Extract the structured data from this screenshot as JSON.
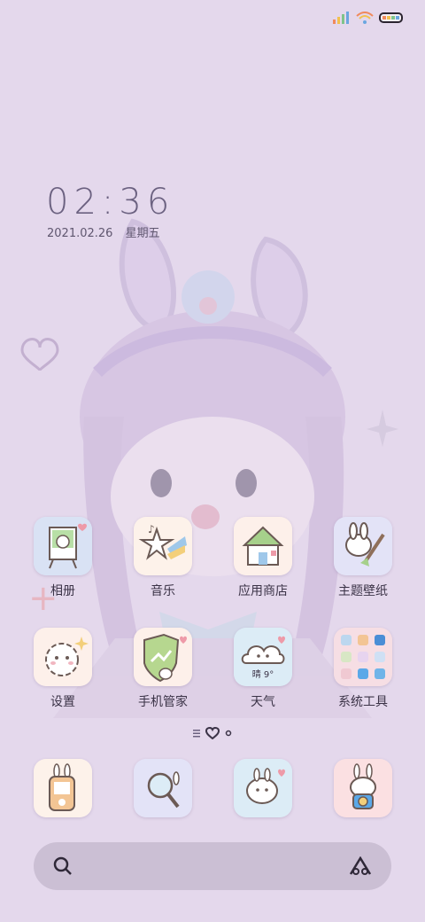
{
  "clock": {
    "time": "02:36",
    "date": "2021.02.26",
    "weekday": "星期五"
  },
  "status_bar": {
    "icons": [
      "signal-icon",
      "wifi-icon",
      "battery-icon"
    ]
  },
  "apps": [
    {
      "label": "相册",
      "icon": "gallery-icon"
    },
    {
      "label": "音乐",
      "icon": "music-icon"
    },
    {
      "label": "应用商店",
      "icon": "app-store-icon"
    },
    {
      "label": "主题壁纸",
      "icon": "themes-icon"
    },
    {
      "label": "设置",
      "icon": "settings-icon"
    },
    {
      "label": "手机管家",
      "icon": "security-icon"
    },
    {
      "label": "天气",
      "icon": "weather-icon",
      "widget_text": "晴 9°"
    },
    {
      "label": "系统工具",
      "icon": "system-tools-folder-icon"
    }
  ],
  "dock": [
    {
      "icon": "phone-icon"
    },
    {
      "icon": "browser-icon"
    },
    {
      "icon": "messages-icon"
    },
    {
      "icon": "camera-icon"
    }
  ],
  "search": {
    "icon": "search-icon",
    "assistant_icon": "assistant-icon"
  },
  "colors": {
    "background": "#e4d8ec",
    "text": "#3b3347",
    "clock": "#6b6180",
    "search_bar": "#cbbfd4"
  }
}
